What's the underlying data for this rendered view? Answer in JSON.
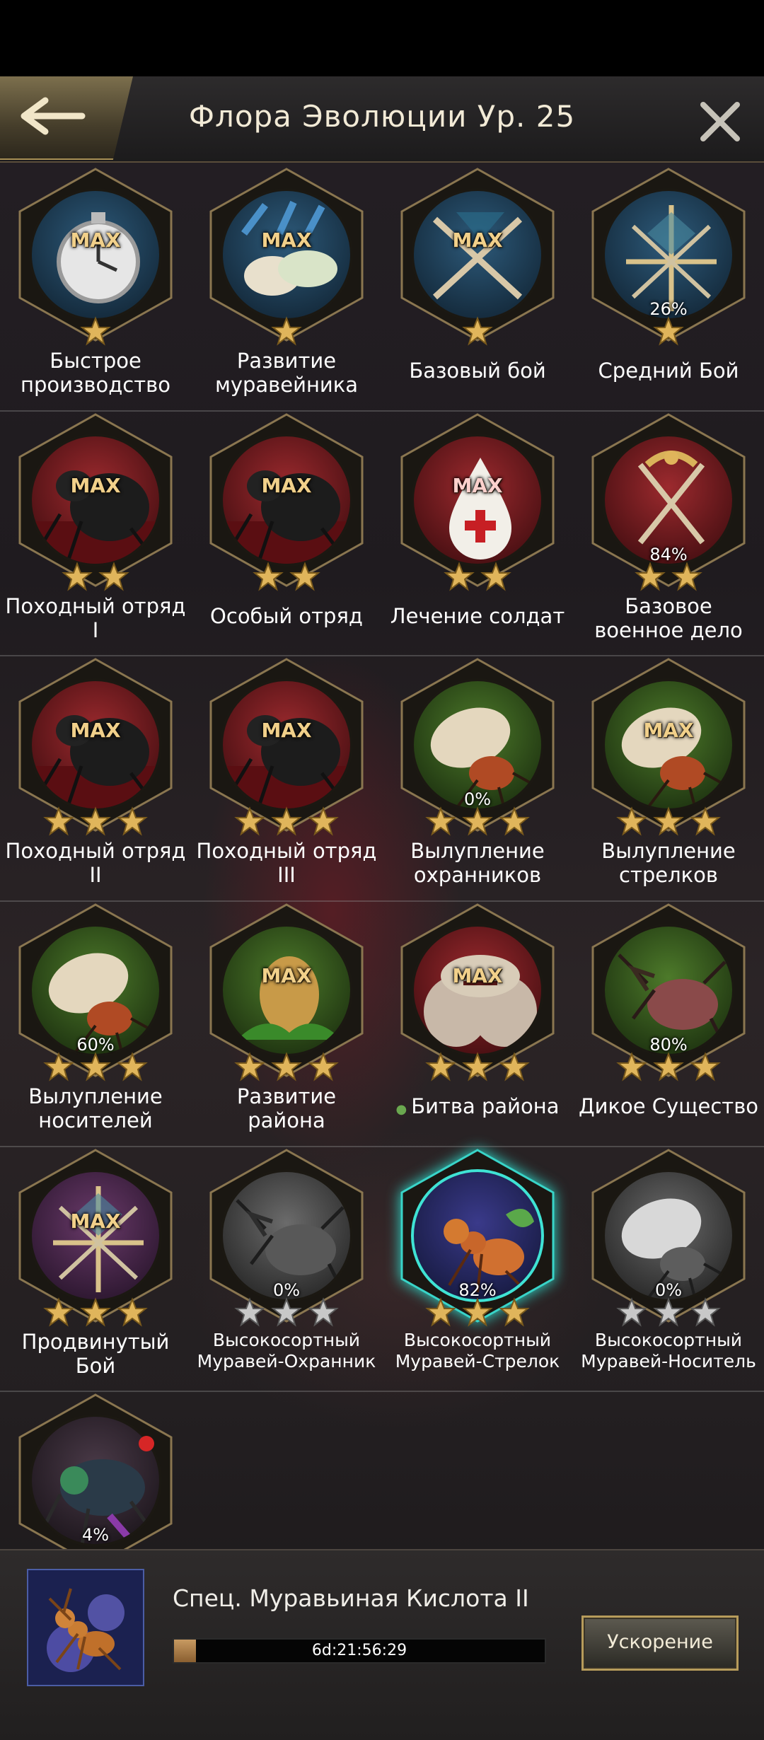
{
  "header": {
    "title": "Флора Эволюции Ур. 25"
  },
  "colors": {
    "gold_star": "#e0b55b",
    "silver_star": "#c8c8c8",
    "accent_gold": "#b79c5b"
  },
  "tiles": [
    {
      "label": "Быстрое\nпроизводство",
      "status": "MAX",
      "stars": 1,
      "filled": 1,
      "theme": "blue",
      "icon": "stopwatch-icon"
    },
    {
      "label": "Развитие\nмуравейника",
      "status": "MAX",
      "stars": 1,
      "filled": 1,
      "theme": "blue",
      "icon": "larvae-icon"
    },
    {
      "label": "Базовый бой",
      "status": "MAX",
      "stars": 1,
      "filled": 1,
      "theme": "blue",
      "icon": "crossed-swords-icon"
    },
    {
      "label": "Средний Бой",
      "status": "26%",
      "stars": 1,
      "filled": 1,
      "theme": "blue",
      "icon": "swords-emblem-icon"
    },
    {
      "label": "Походный отряд\nI",
      "status": "MAX",
      "stars": 2,
      "filled": 2,
      "theme": "red",
      "icon": "black-ant-icon"
    },
    {
      "label": "Особый отряд",
      "status": "MAX",
      "stars": 2,
      "filled": 2,
      "theme": "red",
      "icon": "black-ant-icon"
    },
    {
      "label": "Лечение солдат",
      "status": "MAX",
      "stars": 2,
      "filled": 2,
      "theme": "red",
      "icon": "blood-drop-icon"
    },
    {
      "label": "Базовое\nвоенное дело",
      "status": "84%",
      "stars": 2,
      "filled": 2,
      "theme": "red",
      "icon": "laurel-swords-icon"
    },
    {
      "label": "Походный отряд\nII",
      "status": "MAX",
      "stars": 3,
      "filled": 3,
      "theme": "red",
      "icon": "black-ant-icon"
    },
    {
      "label": "Походный отряд\nIII",
      "status": "MAX",
      "stars": 3,
      "filled": 3,
      "theme": "red",
      "icon": "black-ant-icon"
    },
    {
      "label": "Вылупление\nохранников",
      "status": "0%",
      "stars": 3,
      "filled": 3,
      "theme": "green",
      "icon": "egg-ant-icon"
    },
    {
      "label": "Вылупление\nстрелков",
      "status": "MAX",
      "stars": 3,
      "filled": 3,
      "theme": "green",
      "icon": "egg-ant-icon"
    },
    {
      "label": "Вылупление\nносителей",
      "status": "60%",
      "stars": 3,
      "filled": 3,
      "theme": "green",
      "icon": "egg-ant-icon"
    },
    {
      "label": "Развитие\nрайона",
      "status": "MAX",
      "stars": 3,
      "filled": 3,
      "theme": "green",
      "icon": "pinecone-icon"
    },
    {
      "label": "Битва района",
      "status": "MAX",
      "stars": 3,
      "filled": 3,
      "theme": "red",
      "icon": "plant-creature-icon",
      "leaf": true
    },
    {
      "label": "Дикое Существо",
      "status": "80%",
      "stars": 3,
      "filled": 3,
      "theme": "green",
      "icon": "beetle-icon"
    },
    {
      "label": "Продвинутый\nБой",
      "status": "MAX",
      "stars": 3,
      "filled": 3,
      "theme": "purple",
      "icon": "swords-emblem-icon"
    },
    {
      "label": "Высокосортный\nМуравей-Охранник",
      "status": "0%",
      "stars": 3,
      "filled": 0,
      "theme": "gray",
      "icon": "beetle-icon",
      "small": true
    },
    {
      "label": "Высокосортный\nМуравей-Стрелок",
      "status": "82%",
      "stars": 3,
      "filled": 3,
      "theme": "teal",
      "icon": "fire-ant-icon",
      "small": true
    },
    {
      "label": "Высокосортный\nМуравей-Носитель",
      "status": "0%",
      "stars": 3,
      "filled": 0,
      "theme": "gray",
      "icon": "egg-ant-icon",
      "small": true
    },
    {
      "label": "",
      "status": "4%",
      "stars": 0,
      "filled": 0,
      "theme": "dark",
      "icon": "green-ant-icon"
    }
  ],
  "research": {
    "name": "Спец. Муравьиная Кислота II",
    "timer": "6d:21:56:29",
    "progress": 0.06,
    "speedup_label": "Ускорение"
  }
}
